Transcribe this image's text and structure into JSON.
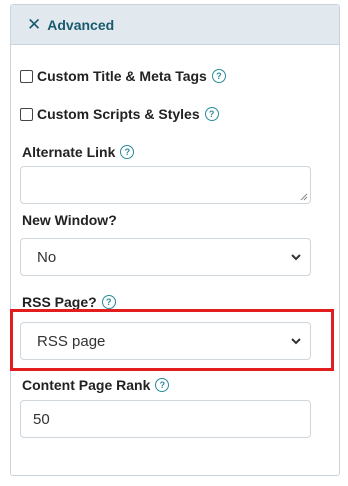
{
  "header": {
    "title": "Advanced",
    "collapse_icon": "close-icon"
  },
  "fields": {
    "custom_title": {
      "label": "Custom Title & Meta Tags",
      "checked": false
    },
    "custom_scripts": {
      "label": "Custom Scripts & Styles",
      "checked": false
    },
    "alternate_link": {
      "label": "Alternate Link",
      "value": ""
    },
    "new_window": {
      "label": "New Window?",
      "selected": "No"
    },
    "rss_page": {
      "label": "RSS Page?",
      "selected": "RSS page"
    },
    "content_page_rank": {
      "label": "Content Page Rank",
      "value": "50"
    }
  },
  "help_glyph": "?",
  "colors": {
    "accent": "#1a5a6e",
    "help": "#2a8a9a",
    "highlight": "#e21d1d"
  }
}
